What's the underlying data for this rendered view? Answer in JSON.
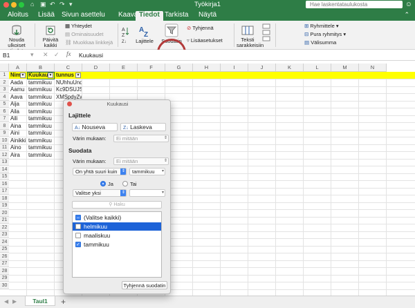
{
  "window": {
    "title": "Työkirja1",
    "search_placeholder": "Hae laskentataulukosta",
    "accent": "#2e7d46"
  },
  "tabs": [
    {
      "label": "Aloitus",
      "active": false
    },
    {
      "label": "Lisää",
      "active": false
    },
    {
      "label": "Sivun asettelu",
      "active": false
    },
    {
      "label": "Kaavat",
      "active": false
    },
    {
      "label": "Tiedot",
      "active": true
    },
    {
      "label": "Tarkista",
      "active": false
    },
    {
      "label": "Näytä",
      "active": false
    }
  ],
  "ribbon": {
    "get_data": "Nouda ulkoiset tiedot",
    "refresh_all": "Päivitä kaikki",
    "connections": "Yhteydet",
    "properties": "Ominaisuudet",
    "edit_links": "Muokkaa linkkejä",
    "sort_label": "Lajittele",
    "filter_label": "Suodatin",
    "clear_label": "Tyhjennä",
    "advanced_label": "Lisäasetukset",
    "text_to_columns": "Teksti sarakkeisiin",
    "group": "Ryhmittele",
    "ungroup": "Pura ryhmitys",
    "subtotal": "Välisumma"
  },
  "formula_bar": {
    "cell_ref": "B1",
    "fx": "fx",
    "value": "Kuukausi"
  },
  "grid": {
    "columns": [
      "A",
      "B",
      "C",
      "D",
      "E",
      "F",
      "G",
      "H",
      "I",
      "J",
      "K",
      "L",
      "M",
      "N"
    ],
    "row_numbers": [
      "1",
      "2",
      "3",
      "4",
      "5",
      "6",
      "7",
      "8",
      "9",
      "10",
      "11",
      "12",
      "13",
      "14",
      "15",
      "16",
      "17",
      "18",
      "19",
      "20",
      "21",
      "22",
      "23",
      "24",
      "25",
      "26",
      "27",
      "28",
      "29",
      "30",
      "31"
    ],
    "header": [
      "Nimi",
      "Kuukausi",
      "tunnus"
    ],
    "rows": [
      [
        "Aada",
        "tammikuu",
        "NUhhuUnq"
      ],
      [
        "Aamu",
        "tammikuu",
        "Kc9DSUJS"
      ],
      [
        "Aava",
        "tammikuu",
        "XMSpdyZw"
      ],
      [
        "Aija",
        "tammikuu",
        ""
      ],
      [
        "Aila",
        "tammikuu",
        ""
      ],
      [
        "Aili",
        "tammikuu",
        ""
      ],
      [
        "Aina",
        "tammikuu",
        ""
      ],
      [
        "Aini",
        "tammikuu",
        ""
      ],
      [
        "Ainikki",
        "tammikuu",
        ""
      ],
      [
        "Aino",
        "tammikuu",
        ""
      ],
      [
        "Aira",
        "tammikuu",
        ""
      ]
    ],
    "header_fill": "#ffff00"
  },
  "sheet_tabs": {
    "active": "Taul1",
    "add": "+"
  },
  "filter_popup": {
    "title": "Kuukausi",
    "sort_heading": "Lajittele",
    "ascending": "Nouseva",
    "descending": "Laskeva",
    "by_color_label": "Värin mukaan:",
    "sort_color_value": "Ei mitään",
    "filter_heading": "Suodata",
    "filter_color_value": "Ei mitään",
    "condition1": "On yhtä suuri kuin",
    "value1": "tammikuu",
    "and_label": "Ja",
    "or_label": "Tai",
    "condition2": "Valitse yksi",
    "value2": "",
    "search_placeholder": "Haku",
    "items": [
      {
        "label": "(Valitse kaikki)",
        "state": "mixed",
        "selected": false
      },
      {
        "label": "helmikuu",
        "state": "off",
        "selected": true
      },
      {
        "label": "maaliskuu",
        "state": "off",
        "selected": false
      },
      {
        "label": "tammikuu",
        "state": "on",
        "selected": false
      }
    ],
    "clear_button": "Tyhjennä suodatin"
  }
}
